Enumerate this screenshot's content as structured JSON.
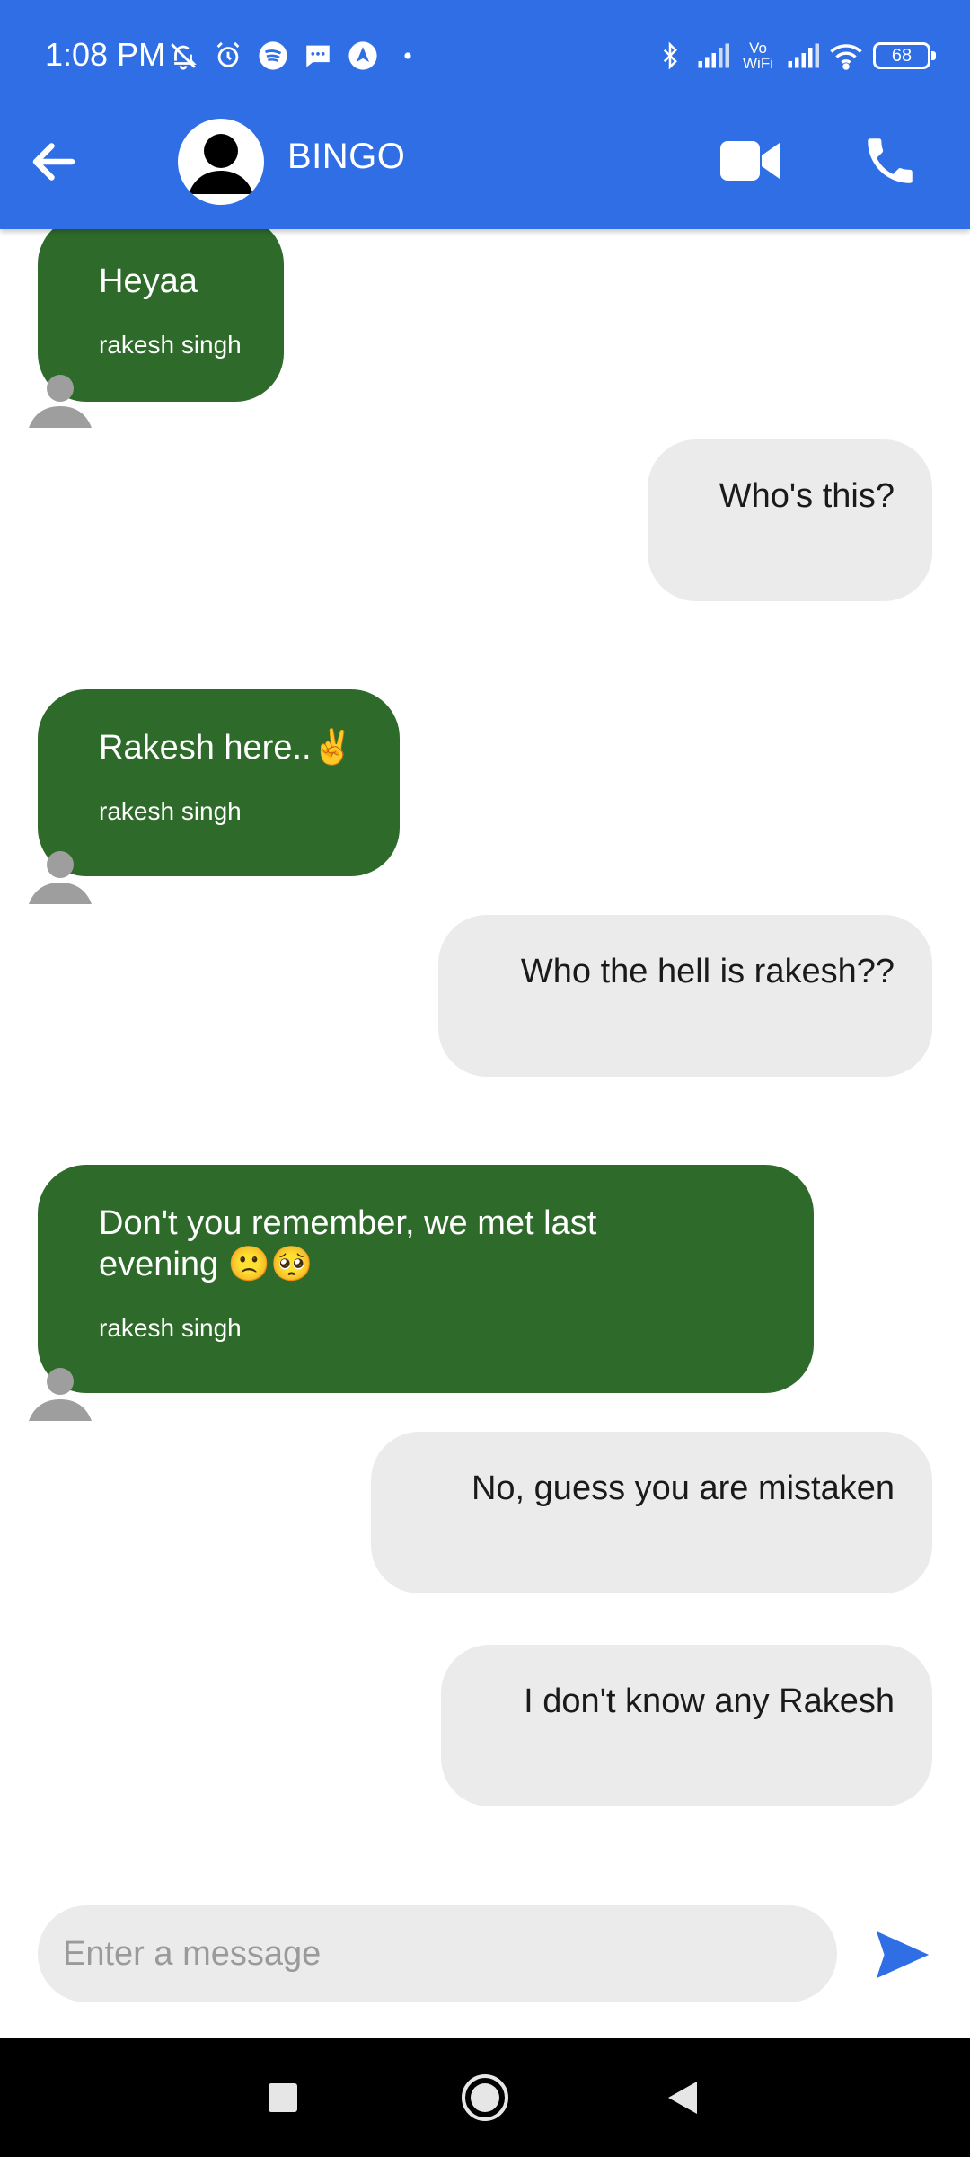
{
  "status_bar": {
    "time": "1:08 PM",
    "battery": "68",
    "vowifi_top": "Vo",
    "vowifi_bottom": "WiFi",
    "icons_left": [
      "mute-notification-icon",
      "alarm-icon",
      "spotify-icon",
      "message-icon",
      "navigation-app-icon",
      "more-dot-icon"
    ],
    "icons_right": [
      "bluetooth-icon",
      "signal-icon",
      "vowifi-icon",
      "signal-icon",
      "wifi-icon",
      "battery-icon"
    ]
  },
  "header": {
    "contact_name": "BINGO",
    "back_icon": "arrow-back-icon",
    "video_icon": "videocam-icon",
    "call_icon": "phone-icon",
    "color": "#2f6ee5"
  },
  "messages": [
    {
      "direction": "in",
      "text": "Heyaa",
      "sender": "rakesh singh"
    },
    {
      "direction": "out",
      "text": "Who's this?"
    },
    {
      "direction": "in",
      "text": "Rakesh here..✌️",
      "sender": "rakesh singh"
    },
    {
      "direction": "out",
      "text": "Who the hell is rakesh??"
    },
    {
      "direction": "in",
      "text": "Don't you remember, we met last evening 🙁🥺",
      "sender": "rakesh singh"
    },
    {
      "direction": "out",
      "text": "No,  guess you are mistaken"
    },
    {
      "direction": "out",
      "text": "I don't know any Rakesh"
    }
  ],
  "composer": {
    "placeholder": "Enter a message",
    "send_icon": "send-icon"
  },
  "nav_bar": {
    "icons": [
      "recents-square-icon",
      "home-circle-icon",
      "back-triangle-icon"
    ]
  },
  "colors": {
    "incoming_bubble": "#2e6b2a",
    "outgoing_bubble": "#ebebeb",
    "accent": "#2f6ee5"
  }
}
